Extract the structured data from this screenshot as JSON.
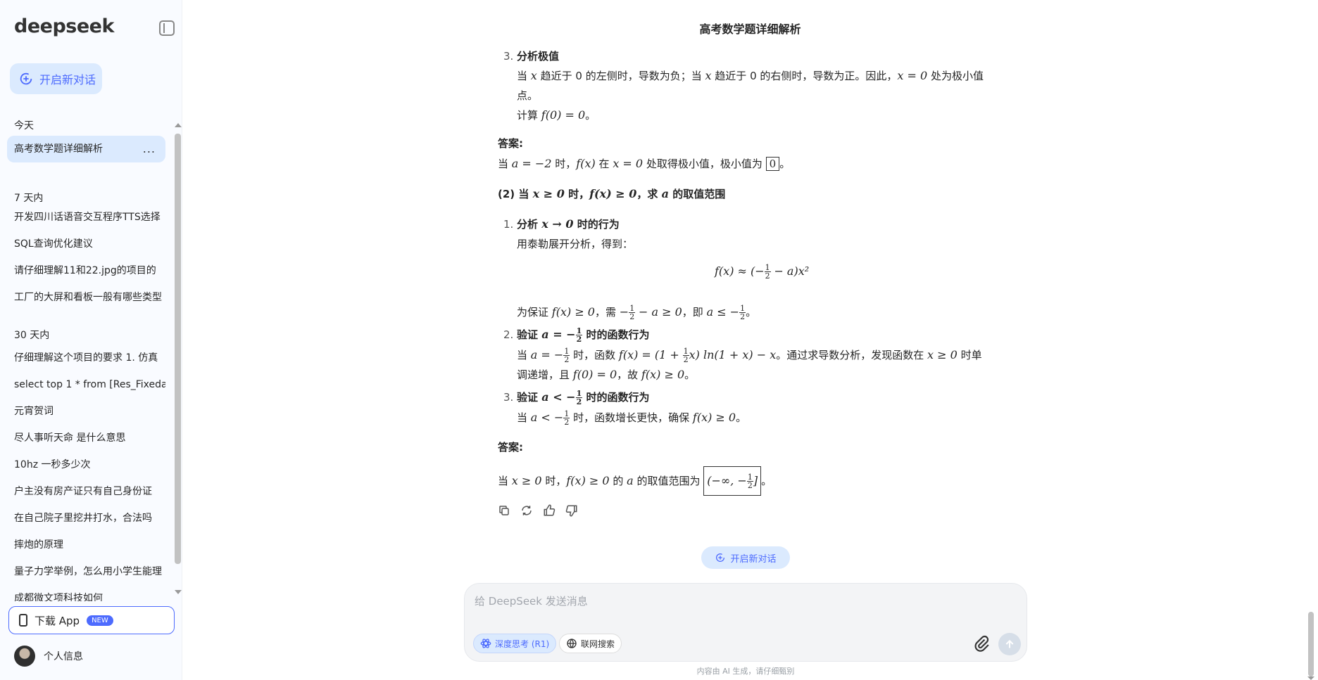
{
  "sidebar": {
    "logo": "deepseek",
    "new_chat": "开启新对话",
    "groups": {
      "today": "今天",
      "seven_days": "7 天内",
      "thirty_days": "30 天内"
    },
    "today_items": [
      "高考数学题详细解析"
    ],
    "seven_day_items": [
      "开发四川话语音交互程序TTS选择",
      "SQL查询优化建议",
      "请仔细理解11和22.jpg的项目的",
      "工厂的大屏和看板一般有哪些类型"
    ],
    "thirty_day_items": [
      "仔细理解这个项目的要求 1. 仿真",
      "select top 1 * from [Res_Fixeda",
      "元宵贺词",
      "尽人事听天命 是什么意思",
      "10hz 一秒多少次",
      "户主没有房产证只有自己身份证",
      "在自己院子里挖井打水，合法吗",
      "摔炮的原理",
      "量子力学举例，怎么用小学生能理",
      "成都微文项科技如何"
    ],
    "more_icon": "...",
    "download": "下载 App",
    "download_badge": "NEW",
    "profile": "个人信息"
  },
  "chat": {
    "title": "高考数学题详细解析",
    "step3_num": "3.",
    "step3_title": "分析极值",
    "step3_line1a": "当",
    "step3_line1b": "趋近于 0 的左侧时，导数为负；当",
    "step3_line1c": "趋近于 0 的右侧时，导数为正。因此，",
    "step3_line1d": "处为极小值",
    "step3_line2": "点。",
    "step3_line3a": "计算",
    "step3_line3b": "f(0) = 0",
    "step3_line3c": "。",
    "answer_label": "答案:",
    "ans1a": "当",
    "ans1b": "a = −2",
    "ans1c": "时，",
    "ans1d": "f(x)",
    "ans1e": "在",
    "ans1f": "x = 0",
    "ans1g": "处取得极小值，极小值为",
    "ans1_box": "0",
    "ans1h": "。",
    "part2_a": "(2) 当",
    "part2_b": "x ≥ 0",
    "part2_c": "时，",
    "part2_d": "f(x) ≥ 0",
    "part2_e": "，求",
    "part2_f": "a",
    "part2_g": "的取值范围",
    "p1_num": "1.",
    "p1_title_a": "分析",
    "p1_title_b": "x → 0",
    "p1_title_c": "时的行为",
    "p1_line1": "用泰勒展开分析，得到：",
    "p1_formula_a": "f(x) ≈ (−",
    "p1_formula_n": "1",
    "p1_formula_d": "2",
    "p1_formula_b": "− a)x²",
    "p1_line3a": "为保证",
    "p1_line3b": "f(x) ≥ 0",
    "p1_line3c": "，需",
    "p1_line3d": "− a ≥ 0",
    "p1_line3e": "，即",
    "p1_line3f": "a ≤ −",
    "p1_line3g": "。",
    "p2_num": "2.",
    "p2_title_a": "验证",
    "p2_title_b": "a = −",
    "p2_title_c": "时的函数行为",
    "p2_line1a": "当",
    "p2_line1b": "a = −",
    "p2_line1c": "时，函数",
    "p2_line1d": "f(x) = (1 +",
    "p2_line1e": "x) ln(1 + x) − x",
    "p2_line1f": "。通过求导数分析，发现函数在",
    "p2_line1g": "x ≥ 0",
    "p2_line1h": "时单",
    "p2_line2a": "调递增，且",
    "p2_line2b": "f(0) = 0",
    "p2_line2c": "，故",
    "p2_line2d": "f(x) ≥ 0",
    "p2_line2e": "。",
    "p3_num": "3.",
    "p3_title_a": "验证",
    "p3_title_b": "a < −",
    "p3_title_c": "时的函数行为",
    "p3_line1a": "当",
    "p3_line1b": "a < −",
    "p3_line1c": "时，函数增长更快，确保",
    "p3_line1d": "f(x) ≥ 0",
    "p3_line1e": "。",
    "answer2_label": "答案:",
    "ans2a": "当",
    "ans2b": "x ≥ 0",
    "ans2c": "时，",
    "ans2d": "f(x) ≥ 0",
    "ans2e": "的",
    "ans2f": "a",
    "ans2g": "的取值范围为",
    "ans2_box_a": "(−∞, −",
    "ans2_box_b": "]",
    "ans2h": "。",
    "var_x": "x",
    "eq_x0": "x = 0",
    "half_n": "1",
    "half_d": "2"
  },
  "composer": {
    "new_chat_pill": "开启新对话",
    "placeholder": "给 DeepSeek 发送消息",
    "deep_think": "深度思考 (R1)",
    "web_search": "联网搜索",
    "disclaimer": "内容由 AI 生成，请仔细甄别"
  },
  "colors": {
    "accent": "#4d6bfe",
    "accent_light": "#dbeafe",
    "sidebar_bg": "#f9fbff"
  }
}
